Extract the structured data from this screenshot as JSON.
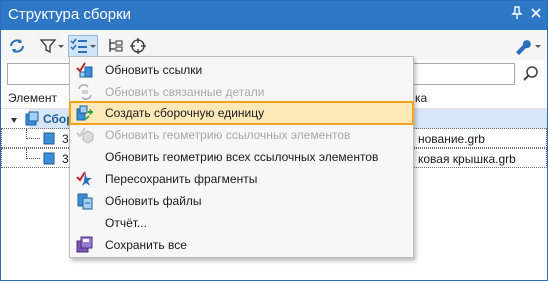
{
  "window": {
    "title": "Структура сборки",
    "pin_icon": "pin-icon",
    "close_icon": "close-icon"
  },
  "toolbar": {
    "buttons": [
      {
        "name": "refresh-icon"
      },
      {
        "name": "filter-icon"
      },
      {
        "name": "list-options-icon"
      },
      {
        "name": "tree-structure-icon"
      },
      {
        "name": "target-icon"
      },
      {
        "name": "wrench-icon"
      }
    ]
  },
  "filter": {
    "value": "",
    "placeholder": ""
  },
  "columns": {
    "element": "Элемент",
    "file_suffix": "ка"
  },
  "tree": {
    "root_label": "Сбор",
    "rows": [
      {
        "label": "3",
        "file": "нование.grb"
      },
      {
        "label": "3",
        "file": "ковая крышка.grb"
      }
    ]
  },
  "context_menu": {
    "items": [
      {
        "label": "Обновить ссылки",
        "enabled": true,
        "icon": "update-links-icon"
      },
      {
        "label": "Обновить связанные детали",
        "enabled": false,
        "icon": "linked-parts-icon"
      },
      {
        "label": "Создать сборочную единицу",
        "enabled": true,
        "icon": "create-assembly-icon",
        "highlighted": true
      },
      {
        "label": "Обновить геометрию ссылочных элементов",
        "enabled": false,
        "icon": "ref-geometry-icon"
      },
      {
        "label": "Обновить геометрию всех ссылочных элементов",
        "enabled": true,
        "icon": ""
      },
      {
        "label": "Пересохранить фрагменты",
        "enabled": true,
        "icon": "resave-fragments-icon"
      },
      {
        "label": "Обновить файлы",
        "enabled": true,
        "icon": "update-files-icon"
      },
      {
        "label": "Отчёт...",
        "enabled": true,
        "icon": ""
      },
      {
        "label": "Сохранить все",
        "enabled": true,
        "icon": "save-all-icon"
      }
    ]
  },
  "colors": {
    "titlebar": "#2e77c7",
    "highlight_fill": "#fde9b8",
    "highlight_border": "#f1a21f"
  }
}
